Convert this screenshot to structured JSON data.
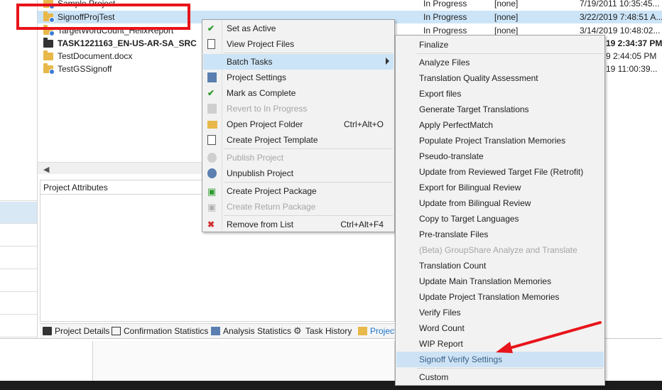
{
  "projects": [
    {
      "name": "Sample Project",
      "status": "",
      "none": "",
      "date": "7/19/2011 10:35:45...",
      "bold": false
    },
    {
      "name": "SignoffProjTest",
      "status": "In Progress",
      "none": "[none]",
      "date": "3/22/2019 7:48:51 A...",
      "bold": false
    },
    {
      "name": "TargetWordCount_HelixReport",
      "status": "In Progress",
      "none": "[none]",
      "date": "3/14/2019 10:48:02...",
      "bold": false
    },
    {
      "name": "TASK1221163_EN-US-AR-SA_SRC",
      "status": "",
      "none": "",
      "date": "19 2:34:37 PM",
      "bold": true
    },
    {
      "name": "TestDocument.docx",
      "status": "",
      "none": "",
      "date": "9 2:44:05 PM",
      "bold": false
    },
    {
      "name": "TestGSSignoff",
      "status": "",
      "none": "",
      "date": "19 11:00:39...",
      "bold": false
    }
  ],
  "first_row_status": "In Progress",
  "first_row_none": "[none]",
  "attributes_title": "Project Attributes",
  "bottom_tabs": [
    "Project Details",
    "Confirmation Statistics",
    "Analysis Statistics",
    "Task History",
    "Project"
  ],
  "context_menu": {
    "set_active": "Set as Active",
    "view_files": "View Project Files",
    "batch_tasks": "Batch Tasks",
    "project_settings": "Project Settings",
    "mark_complete": "Mark as Complete",
    "revert": "Revert to In Progress",
    "open_folder": "Open Project Folder",
    "open_folder_shortcut": "Ctrl+Alt+O",
    "create_template": "Create Project Template",
    "publish": "Publish Project",
    "unpublish": "Unpublish Project",
    "create_package": "Create Project Package",
    "create_return": "Create Return Package",
    "remove": "Remove from List",
    "remove_shortcut": "Ctrl+Alt+F4"
  },
  "submenu": [
    {
      "label": "Finalize",
      "disabled": false
    },
    {
      "label": "Analyze Files",
      "disabled": false
    },
    {
      "label": "Translation Quality Assessment",
      "disabled": false
    },
    {
      "label": "Export files",
      "disabled": false
    },
    {
      "label": "Generate Target Translations",
      "disabled": false
    },
    {
      "label": "Apply PerfectMatch",
      "disabled": false
    },
    {
      "label": "Populate Project Translation Memories",
      "disabled": false
    },
    {
      "label": "Pseudo-translate",
      "disabled": false
    },
    {
      "label": "Update from Reviewed Target File (Retrofit)",
      "disabled": false
    },
    {
      "label": "Export for Bilingual Review",
      "disabled": false
    },
    {
      "label": "Update from Bilingual Review",
      "disabled": false
    },
    {
      "label": "Copy to Target Languages",
      "disabled": false
    },
    {
      "label": "Pre-translate Files",
      "disabled": false
    },
    {
      "label": "(Beta) GroupShare Analyze and Translate",
      "disabled": true
    },
    {
      "label": "Translation Count",
      "disabled": false
    },
    {
      "label": "Update Main Translation Memories",
      "disabled": false
    },
    {
      "label": "Update Project Translation Memories",
      "disabled": false
    },
    {
      "label": "Verify Files",
      "disabled": false
    },
    {
      "label": "Word Count",
      "disabled": false
    },
    {
      "label": "WIP Report",
      "disabled": false
    },
    {
      "label": "Signoff Verify Settings",
      "disabled": false,
      "highlight": true
    },
    {
      "label": "Custom",
      "disabled": false
    }
  ],
  "colors": {
    "highlight": "#cce4f7",
    "annotation_red": "#e8141b",
    "disabled_text": "#a6a6a6"
  }
}
